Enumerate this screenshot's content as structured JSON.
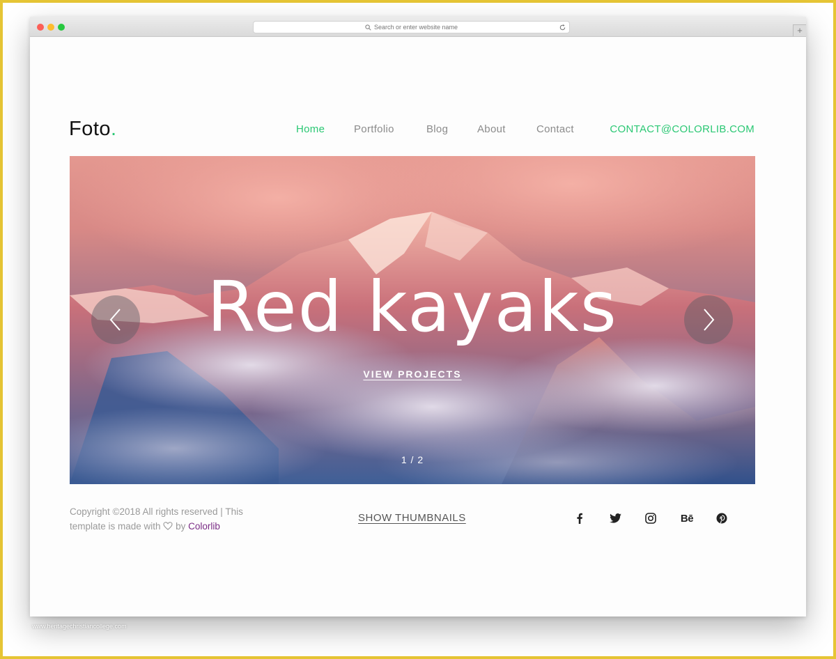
{
  "browser": {
    "url_placeholder": "Search or enter website name",
    "new_tab": "+"
  },
  "site": {
    "logo_text": "Foto",
    "logo_dot": ".",
    "accent_color": "#2bc874",
    "nav": [
      {
        "label": "Home",
        "active": true
      },
      {
        "label": "Portfolio",
        "active": false
      },
      {
        "label": "Blog",
        "active": false
      },
      {
        "label": "About",
        "active": false
      },
      {
        "label": "Contact",
        "active": false
      }
    ],
    "contact_email": "CONTACT@COLORLIB.COM"
  },
  "hero": {
    "title": "Red kayaks",
    "cta": "VIEW PROJECTS",
    "counter": "1 / 2",
    "prev_icon": "chevron-left-icon",
    "next_icon": "chevron-right-icon"
  },
  "footer": {
    "copyright_line1": "Copyright ©2018 All rights reserved | This",
    "copyright_line2a": "template is made with",
    "copyright_line2b": "by",
    "brand": "Colorlib",
    "brand_color": "#7a2b85",
    "show_thumbnails": "SHOW THUMBNAILS",
    "social": [
      "facebook-icon",
      "twitter-icon",
      "instagram-icon",
      "behance-icon",
      "pinterest-icon"
    ],
    "behance_text": "Bē"
  },
  "watermark": "www.heritagechristiancollege.com"
}
